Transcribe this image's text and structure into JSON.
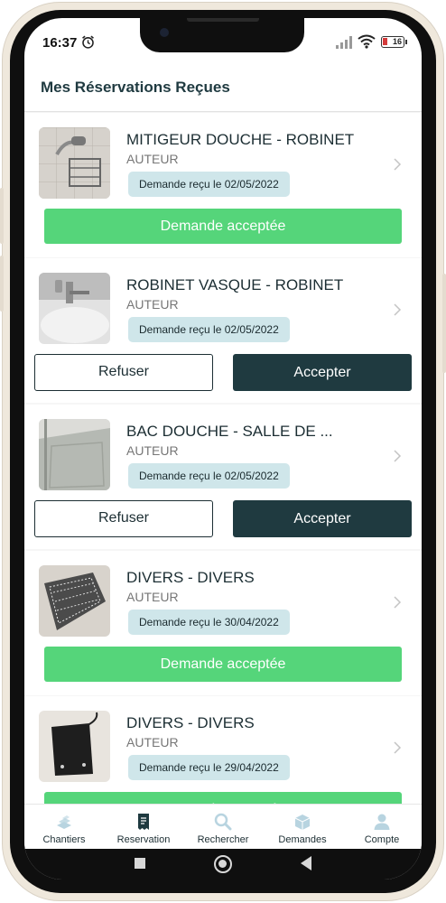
{
  "status_bar": {
    "time": "16:37",
    "battery": "16"
  },
  "header": {
    "title": "Mes Réservations Reçues"
  },
  "reservations": [
    {
      "title": "MITIGEUR DOUCHE - ROBINET",
      "author": "AUTEUR",
      "date_label": "Demande reçu le 02/05/2022",
      "accepted_label": "Demande acceptée"
    },
    {
      "title": "ROBINET VASQUE - ROBINET",
      "author": "AUTEUR",
      "date_label": "Demande reçu le 02/05/2022",
      "refuse_label": "Refuser",
      "accept_label": "Accepter"
    },
    {
      "title": "BAC DOUCHE - SALLE DE ...",
      "author": "AUTEUR",
      "date_label": "Demande reçu le 02/05/2022",
      "refuse_label": "Refuser",
      "accept_label": "Accepter"
    },
    {
      "title": "DIVERS - DIVERS",
      "author": "AUTEUR",
      "date_label": "Demande reçu le 30/04/2022",
      "accepted_label": "Demande acceptée"
    },
    {
      "title": "DIVERS - DIVERS",
      "author": "AUTEUR",
      "date_label": "Demande reçu le 29/04/2022",
      "accepted_label": "Demande acceptée"
    }
  ],
  "bottom_nav": {
    "items": [
      {
        "label": "Chantiers",
        "icon": "bricks-icon"
      },
      {
        "label": "Reservation",
        "icon": "receipt-icon",
        "active": true
      },
      {
        "label": "Rechercher",
        "icon": "search-icon"
      },
      {
        "label": "Demandes",
        "icon": "boxes-icon"
      },
      {
        "label": "Compte",
        "icon": "user-icon"
      }
    ]
  },
  "colors": {
    "primary_dark": "#1f3a40",
    "accepted_green": "#55d57a",
    "chip_bg": "#cfe6ea",
    "nav_inactive": "#b8d4e0"
  }
}
